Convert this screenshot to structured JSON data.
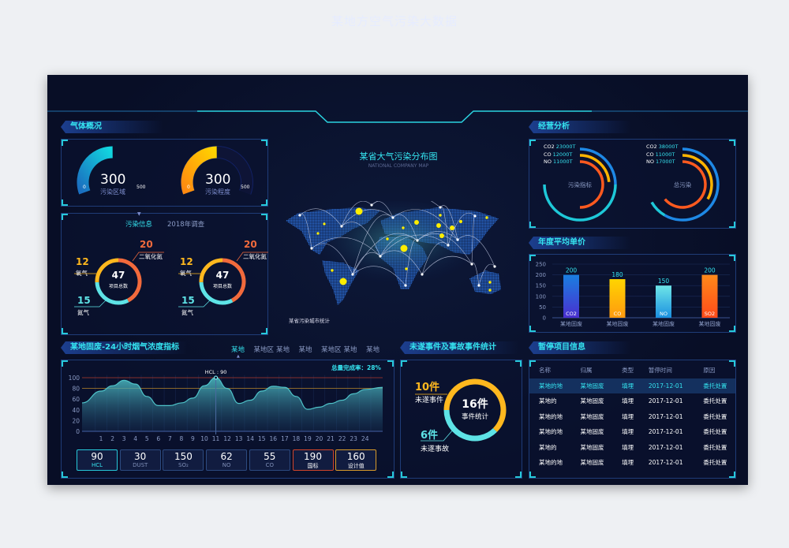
{
  "header": {
    "title": "某地方空气污染大数据"
  },
  "gas": {
    "section": "气体概况",
    "gauges": [
      {
        "value": "300",
        "label": "污染区域",
        "min": "0",
        "max": "500",
        "val": 300,
        "maxv": 500,
        "color": "#1ec8e0"
      },
      {
        "value": "300",
        "label": "污染程度",
        "min": "0",
        "max": "500",
        "val": 300,
        "maxv": 500,
        "color": "#ffb400"
      }
    ],
    "info_tab": "污染信息",
    "survey_tab": "2018年调查",
    "donuts": [
      {
        "total": "47",
        "total_label": "项目总数",
        "items": [
          {
            "value": "20",
            "label": "二氧化氮",
            "color": "#f26a3c",
            "n": 20
          },
          {
            "value": "15",
            "label": "氮气",
            "color": "#5ee3e6",
            "n": 15
          },
          {
            "value": "12",
            "label": "氧气",
            "color": "#ffb81e",
            "n": 12
          }
        ]
      },
      {
        "total": "47",
        "total_label": "项目总数",
        "items": [
          {
            "value": "20",
            "label": "二氧化氮",
            "color": "#f26a3c",
            "n": 20
          },
          {
            "value": "15",
            "label": "氮气",
            "color": "#5ee3e6",
            "n": 15
          },
          {
            "value": "12",
            "label": "氧气",
            "color": "#ffb81e",
            "n": 12
          }
        ]
      }
    ]
  },
  "map": {
    "title": "某省大气污染分布图",
    "subtitle": "NATIONAL COMPANY MAP",
    "caption": "某省污染城市统计"
  },
  "business": {
    "section": "经营分析",
    "rings": [
      {
        "center": "污染指标",
        "items": [
          {
            "name": "CO2",
            "value": "23000T",
            "color": "#1e88e5"
          },
          {
            "name": "CO",
            "value": "12000T",
            "color": "#ffb400"
          },
          {
            "name": "NO",
            "value": "11000T",
            "color": "#ff5a1f"
          }
        ]
      },
      {
        "center": "总污染",
        "items": [
          {
            "name": "CO2",
            "value": "38000T",
            "color": "#1e88e5"
          },
          {
            "name": "CO",
            "value": "11000T",
            "color": "#ffb400"
          },
          {
            "name": "NO",
            "value": "17000T",
            "color": "#ff5a1f"
          }
        ]
      }
    ]
  },
  "price": {
    "section": "年度平均单价"
  },
  "smoke": {
    "section": "某地固废-24小时烟气浓度指标",
    "completion": "总量完成率：28%",
    "tooltip": "HCL : 90",
    "tabs": [
      "某地",
      "某地区",
      "某地",
      "某地",
      "某地区",
      "某地",
      "某地"
    ],
    "metrics": [
      {
        "value": "90",
        "label": "HCL",
        "border": "#27c9da"
      },
      {
        "value": "30",
        "label": "DUST",
        "border": "#2c4a80"
      },
      {
        "value": "150",
        "label": "SO₂",
        "border": "#2c4a80"
      },
      {
        "value": "62",
        "label": "NO",
        "border": "#2c4a80"
      },
      {
        "value": "55",
        "label": "CO",
        "border": "#2c4a80"
      },
      {
        "value": "190",
        "label": "国标",
        "border": "#d2452a"
      },
      {
        "value": "160",
        "label": "设计值",
        "border": "#d89a2a"
      }
    ]
  },
  "events": {
    "section": "未遂事件及事故事件统计",
    "total": "16件",
    "total_label": "事件统计",
    "items": [
      {
        "value": "10件",
        "label": "未遂事件",
        "color": "#ffb81e",
        "n": 10
      },
      {
        "value": "6件",
        "label": "未遂事故",
        "color": "#5ee3e6",
        "n": 6
      }
    ]
  },
  "suspend": {
    "section": "暂停项目信息",
    "columns": [
      "名称",
      "归属",
      "类型",
      "暂停时间",
      "原因"
    ],
    "rows": [
      [
        "某地的地",
        "某地固废",
        "填埋",
        "2017-12-01",
        "委托处置"
      ],
      [
        "某地的",
        "某地固废",
        "填埋",
        "2017-12-01",
        "委托处置"
      ],
      [
        "某地的地",
        "某地固废",
        "填埋",
        "2017-12-01",
        "委托处置"
      ],
      [
        "某地的地",
        "某地固废",
        "填埋",
        "2017-12-01",
        "委托处置"
      ],
      [
        "某地的",
        "某地固废",
        "填埋",
        "2017-12-01",
        "委托处置"
      ],
      [
        "某地的地",
        "某地固废",
        "填埋",
        "2017-12-01",
        "委托处置"
      ]
    ]
  },
  "chart_data": [
    {
      "type": "area",
      "xlabel": "",
      "ylabel": "",
      "x": [
        1,
        2,
        3,
        4,
        5,
        6,
        7,
        8,
        9,
        10,
        11,
        12,
        13,
        14,
        15,
        16,
        17,
        18,
        19,
        20,
        21,
        22,
        23,
        24
      ],
      "values": [
        75,
        85,
        95,
        88,
        65,
        48,
        48,
        53,
        62,
        85,
        100,
        80,
        52,
        58,
        75,
        84,
        82,
        65,
        41,
        45,
        52,
        58,
        70,
        78
      ],
      "ylim": [
        0,
        100
      ],
      "yticks": [
        0,
        20,
        40,
        60,
        80,
        100
      ],
      "reference_lines": [
        {
          "y": 100,
          "color": "#b03a2e"
        },
        {
          "y": 80,
          "color": "#b8862a"
        }
      ],
      "grid": true,
      "color": "#4fc3c9"
    },
    {
      "type": "bar",
      "categories": [
        "某地固废",
        "某地固废",
        "某地固废",
        "某地固废"
      ],
      "bar_labels": [
        "CO2",
        "CO",
        "NO",
        "SO2"
      ],
      "values": [
        200,
        180,
        150,
        200
      ],
      "ylim": [
        0,
        250
      ],
      "yticks": [
        0,
        50,
        100,
        150,
        200,
        250
      ],
      "colors": [
        [
          "#1a7fe0",
          "#4a2fd0"
        ],
        [
          "#ffd400",
          "#ff9a10"
        ],
        [
          "#6ee6e8",
          "#1a8fe0"
        ],
        [
          "#ff8a1a",
          "#ff4a1a"
        ]
      ]
    }
  ]
}
